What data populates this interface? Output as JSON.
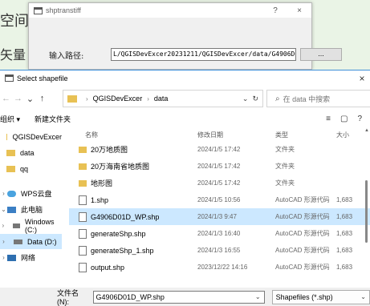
{
  "background": {
    "line1": "空间分",
    "line2": "矢量"
  },
  "small_dialog": {
    "title": "shptranstiff",
    "help_icon": "?",
    "close_icon": "×",
    "path_label": "输入路径:",
    "path_value": "L/QGISDevExcer20231211/QGISDevExcer/data/G4906D01D_WP.shp",
    "browse_label": "..."
  },
  "file_dialog": {
    "title": "Select shapefile",
    "close_icon": "×",
    "nav": {
      "back": "←",
      "forward": "→",
      "up_menu": "⌄",
      "up": "↑"
    },
    "breadcrumb": [
      "QGISDevExcer",
      "data"
    ],
    "search_placeholder": "在 data 中搜索",
    "toolbar": {
      "organize": "组织 ▾",
      "new_folder": "新建文件夹",
      "view_icon": "≡",
      "pane_icon": "▢",
      "help_icon": "?"
    },
    "sidebar": [
      {
        "label": "QGISDevExcer",
        "icon": "folder"
      },
      {
        "label": "data",
        "icon": "folder"
      },
      {
        "label": "qq",
        "icon": "folder"
      },
      {
        "label": "WPS云盘",
        "icon": "cloud"
      },
      {
        "label": "此电脑",
        "icon": "pc"
      },
      {
        "label": "Windows (C:)",
        "icon": "drive"
      },
      {
        "label": "Data (D:)",
        "icon": "drive"
      },
      {
        "label": "网络",
        "icon": "network"
      }
    ],
    "columns": {
      "name": "名称",
      "date": "修改日期",
      "type": "类型",
      "size": "大小"
    },
    "files": [
      {
        "name": "20万地质图",
        "date": "2024/1/5 17:42",
        "type": "文件夹",
        "size": "",
        "kind": "folder"
      },
      {
        "name": "20万海南省地质图",
        "date": "2024/1/5 17:42",
        "type": "文件夹",
        "size": "",
        "kind": "folder"
      },
      {
        "name": "地形图",
        "date": "2024/1/5 17:42",
        "type": "文件夹",
        "size": "",
        "kind": "folder"
      },
      {
        "name": "1.shp",
        "date": "2024/1/5 10:56",
        "type": "AutoCAD 形源代码",
        "size": "1,683",
        "kind": "file"
      },
      {
        "name": "G4906D01D_WP.shp",
        "date": "2024/1/3 9:47",
        "type": "AutoCAD 形源代码",
        "size": "1,683",
        "kind": "file"
      },
      {
        "name": "generateShp.shp",
        "date": "2024/1/3 16:40",
        "type": "AutoCAD 形源代码",
        "size": "1,683",
        "kind": "file"
      },
      {
        "name": "generateShp_1.shp",
        "date": "2024/1/3 16:55",
        "type": "AutoCAD 形源代码",
        "size": "1,683",
        "kind": "file"
      },
      {
        "name": "output.shp",
        "date": "2023/12/22 14:16",
        "type": "AutoCAD 形源代码",
        "size": "1,683",
        "kind": "file"
      }
    ],
    "filename_label": "文件名(N):",
    "filename_value": "G4906D01D_WP.shp",
    "filetype_value": "Shapefiles (*.shp)"
  }
}
